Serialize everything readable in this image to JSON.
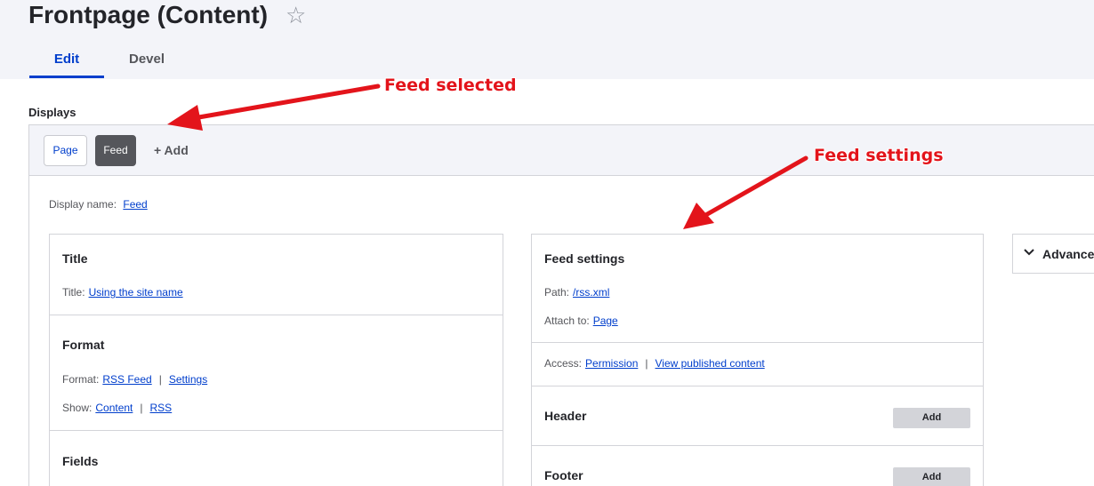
{
  "header": {
    "title": "Frontpage (Content)",
    "star_icon": "star-icon",
    "tabs": [
      {
        "label": "Edit",
        "active": true
      },
      {
        "label": "Devel",
        "active": false
      }
    ]
  },
  "displays": {
    "label": "Displays",
    "buttons": [
      {
        "label": "Page",
        "active": false
      },
      {
        "label": "Feed",
        "active": true
      }
    ],
    "add_label": "+ Add",
    "display_name_label": "Display name:",
    "display_name_value": "Feed"
  },
  "column1": {
    "title_section": {
      "heading": "Title",
      "label": "Title:",
      "value": "Using the site name"
    },
    "format_section": {
      "heading": "Format",
      "format_label": "Format:",
      "format_value": "RSS Feed",
      "format_settings": "Settings",
      "show_label": "Show:",
      "show_value": "Content",
      "show_settings": "RSS"
    },
    "fields_section": {
      "heading": "Fields"
    }
  },
  "column2": {
    "feed_settings": {
      "heading": "Feed settings",
      "path_label": "Path:",
      "path_value": "/rss.xml",
      "attach_label": "Attach to:",
      "attach_value": "Page"
    },
    "access": {
      "label": "Access:",
      "value": "Permission",
      "extra": "View published content"
    },
    "header_section": {
      "heading": "Header",
      "button": "Add"
    },
    "footer_section": {
      "heading": "Footer",
      "button": "Add"
    }
  },
  "advanced": {
    "label": "Advanced",
    "icon": "chevron-down-icon"
  },
  "annotations": {
    "feed_selected": "Feed selected",
    "feed_settings": "Feed settings"
  },
  "colors": {
    "accent": "#003ecc",
    "annotation": "#e3141b",
    "active_display": "#55565b"
  }
}
